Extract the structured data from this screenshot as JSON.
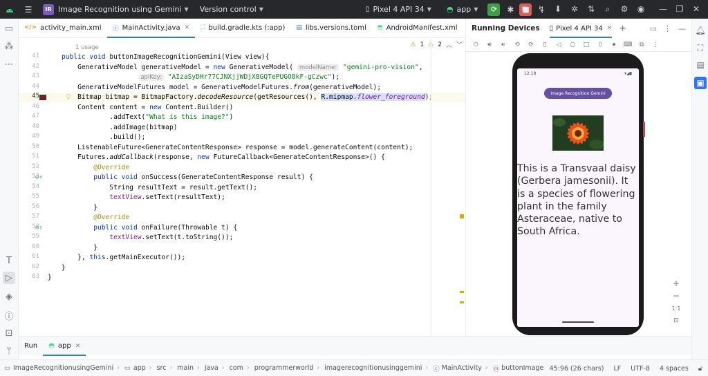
{
  "titlebar": {
    "menu_icon": "hamburger-icon",
    "project_badge": "IR",
    "project_name": "Image Recognition using Gemini",
    "vcs": "Version control",
    "device": "Pixel 4 API 34",
    "run_config": "app",
    "colors": {
      "bg": "#27282c",
      "run_green": "#3f9f46",
      "stop_red": "#db5c5c"
    }
  },
  "tabs": [
    {
      "label": "activity_main.xml",
      "icon": "xml-file-icon"
    },
    {
      "label": "MainActivity.java",
      "icon": "class-file-icon",
      "active": true
    },
    {
      "label": "build.gradle.kts (:app)",
      "icon": "gradle-file-icon"
    },
    {
      "label": "libs.versions.toml",
      "icon": "toml-file-icon"
    },
    {
      "label": "AndroidManifest.xml",
      "icon": "xml-file-icon"
    }
  ],
  "editor": {
    "usages": "1 usage",
    "warnings": "1",
    "weak_warnings": "2",
    "hint_model_name": "modelName:",
    "hint_api_key": "apiKey:",
    "line_numbers": [
      "41",
      "42",
      "43",
      "44",
      "45",
      "46",
      "47",
      "48",
      "49",
      "50",
      "51",
      "52",
      "53",
      "54",
      "55",
      "56",
      "57",
      "58",
      "59",
      "60",
      "61",
      "62",
      "63"
    ],
    "code": {
      "l41a": "public void ",
      "l41b": "buttonImageRecognitionGemini(View view){",
      "l42a": "    GenerativeModel generativeModel = ",
      "l42b": "new ",
      "l42c": "GenerativeModel( ",
      "l42d": "\"gemini-pro-vision\"",
      "l42e": ",",
      "l43a": "            ",
      "l43b": "\"AIzaSyDHr77CJNXjjWDjX8GQTePUGO8kF-gCzwc\"",
      "l43c": ");",
      "l44a": "    GenerativeModelFutures model = GenerativeModelFutures.",
      "l44b": "from",
      "l44c": "(generativeModel);",
      "l45a": "    Bitmap bitmap = BitmapFactory.",
      "l45b": "decodeResource",
      "l45c": "(getResources(), ",
      "l45d": "R.mipmap.",
      "l45e": "flower_foreground",
      "l45f": ");",
      "l46a": "    Content content = ",
      "l46b": "new ",
      "l46c": "Content.Builder()",
      "l47a": "            .addText(",
      "l47b": "\"What is this image?\"",
      "l47c": ")",
      "l48": "            .addImage(bitmap)",
      "l49": "            .build();",
      "l50": "    ListenableFuture<GenerateContentResponse> response = model.generateContent(content);",
      "l51a": "    Futures.",
      "l51b": "addCallback",
      "l51c": "(response, ",
      "l51d": "new ",
      "l51e": "FutureCallback<GenerateContentResponse>() {",
      "l52": "        @Override",
      "l53a": "        ",
      "l53b": "public void ",
      "l53c": "onSuccess(GenerateContentResponse result) {",
      "l54": "            String resultText = result.getText();",
      "l55a": "            ",
      "l55b": "textView",
      "l55c": ".setText(resultText);",
      "l56": "        }",
      "l57": "        @Override",
      "l58a": "        ",
      "l58b": "public void ",
      "l58c": "onFailure(Throwable t) {",
      "l59a": "            ",
      "l59b": "textView",
      "l59c": ".setText(t.toString());",
      "l60": "        }",
      "l61a": "    }, ",
      "l61b": "this",
      "l61c": ".getMainExecutor());",
      "l62": "}",
      "l63": "}"
    }
  },
  "running_devices": {
    "title": "Running Devices",
    "device_tab": "Pixel 4 API 34",
    "add_tab": "+",
    "phone": {
      "time": "12:18",
      "button_label": "Image Recognition Gemini",
      "result_text": " This is a Transvaal daisy (Gerbera jamesonii). It is a species of flowering plant in the family Asteraceae, native to South Africa."
    },
    "zoom": {
      "in": "+",
      "out": "−",
      "actual": "1:1"
    }
  },
  "bottom_tabs": {
    "run": "Run",
    "app": "app"
  },
  "statusbar": {
    "breadcrumbs": [
      "ImageRecognitionusingGemini",
      "app",
      "src",
      "main",
      "java",
      "com",
      "programmerworld",
      "imagerecognitionusinggemini",
      "MainActivity",
      "buttonImageRecognitionGe"
    ],
    "position": "45:96 (26 chars)",
    "line_sep": "LF",
    "encoding": "UTF-8",
    "indent": "4 spaces"
  }
}
